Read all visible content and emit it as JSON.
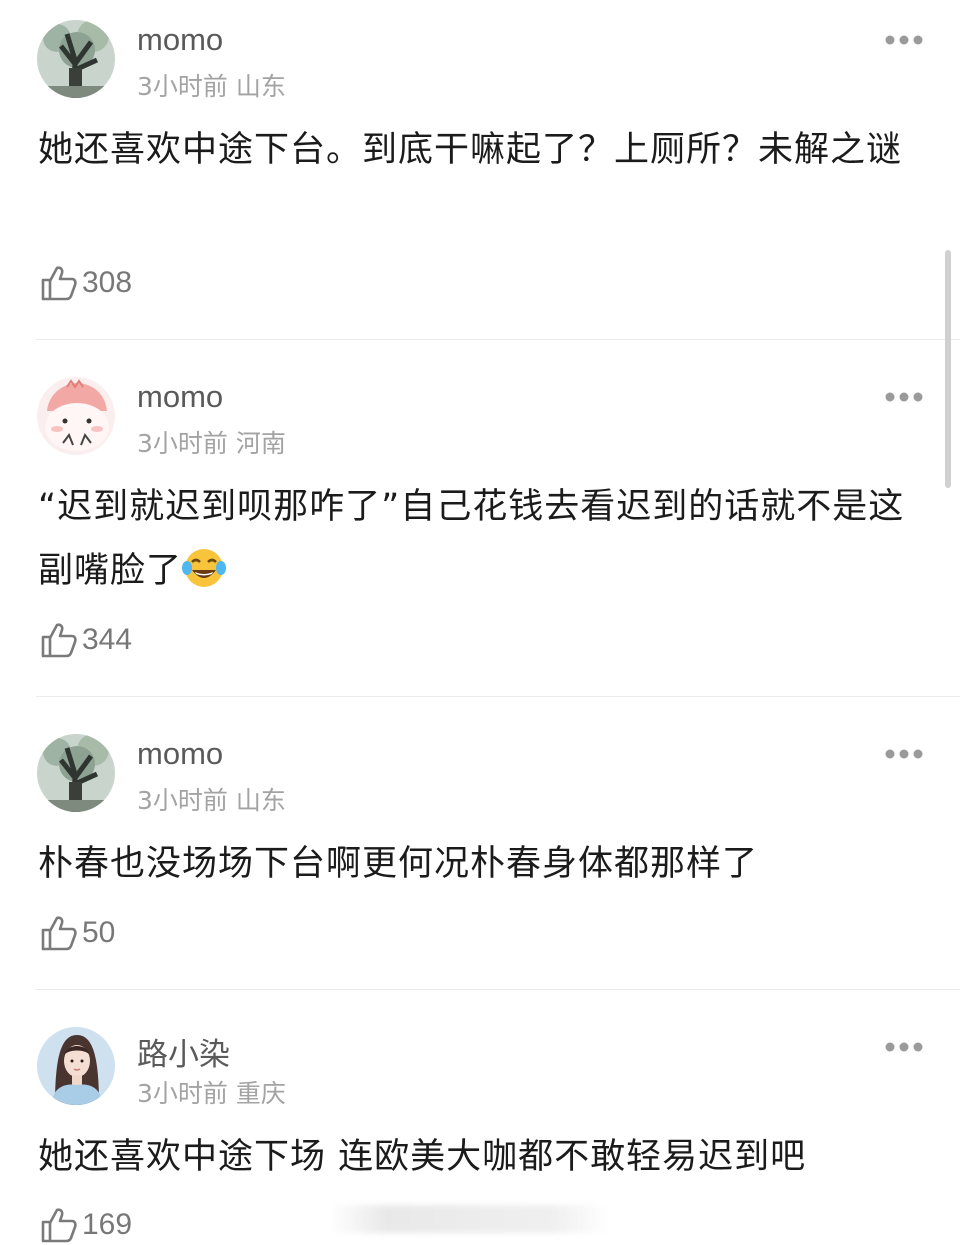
{
  "comments": [
    {
      "avatar": "tree-avatar",
      "username": "momo",
      "meta": "3小时前 山东",
      "text": "她还喜欢中途下台。到底干嘛起了？上厕所？未解之谜",
      "likes": "308"
    },
    {
      "avatar": "cartoon-avatar",
      "username": "momo",
      "meta": "3小时前 河南",
      "text": "“迟到就迟到呗那咋了”自己花钱去看迟到的话就不是这副嘴脸了",
      "emoji": "tears-of-joy-emoji",
      "likes": "344"
    },
    {
      "avatar": "tree-avatar",
      "username": "momo",
      "meta": "3小时前 山东",
      "text": "朴春也没场场下台啊更何况朴春身体都那样了",
      "likes": "50"
    },
    {
      "avatar": "girl-avatar",
      "username": "路小染",
      "meta": "3小时前 重庆",
      "text": "她还喜欢中途下场 连欧美大咖都不敢轻易迟到吧",
      "likes": "169"
    }
  ],
  "icons": {
    "like": "thumbs-up-icon",
    "more": "more-dots-icon"
  },
  "colors": {
    "text": "#1b1b1b",
    "username": "#5a5a5a",
    "meta": "#a3a3a3",
    "divider": "#ebebeb"
  }
}
